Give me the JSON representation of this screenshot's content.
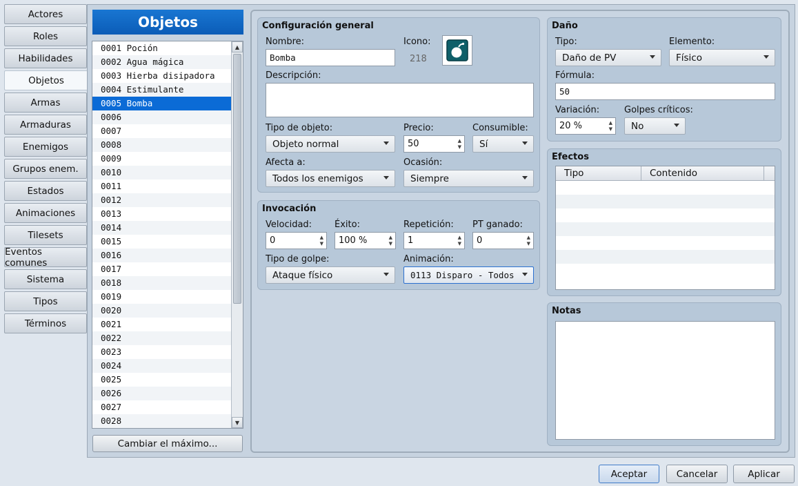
{
  "tabs": [
    "Actores",
    "Roles",
    "Habilidades",
    "Objetos",
    "Armas",
    "Armaduras",
    "Enemigos",
    "Grupos enem.",
    "Estados",
    "Animaciones",
    "Tilesets",
    "Eventos comunes",
    "Sistema",
    "Tipos",
    "Términos"
  ],
  "active_tab": "Objetos",
  "list": {
    "title": "Objetos",
    "items": [
      "0001 Poción",
      "0002 Agua mágica",
      "0003 Hierba disipadora",
      "0004 Estimulante",
      "0005 Bomba",
      "0006",
      "0007",
      "0008",
      "0009",
      "0010",
      "0011",
      "0012",
      "0013",
      "0014",
      "0015",
      "0016",
      "0017",
      "0018",
      "0019",
      "0020",
      "0021",
      "0022",
      "0023",
      "0024",
      "0025",
      "0026",
      "0027",
      "0028"
    ],
    "selected_index": 4,
    "change_max_button": "Cambiar el máximo..."
  },
  "general": {
    "title": "Configuración general",
    "name_label": "Nombre:",
    "name_value": "Bomba",
    "icon_label": "Icono:",
    "icon_index": "218",
    "icon_name": "bomb-icon",
    "description_label": "Descripción:",
    "description_value": "",
    "item_type_label": "Tipo de objeto:",
    "item_type_value": "Objeto normal",
    "price_label": "Precio:",
    "price_value": "50",
    "consumable_label": "Consumible:",
    "consumable_value": "Sí",
    "scope_label": "Afecta a:",
    "scope_value": "Todos los enemigos",
    "occasion_label": "Ocasión:",
    "occasion_value": "Siempre"
  },
  "invocation": {
    "title": "Invocación",
    "speed_label": "Velocidad:",
    "speed_value": "0",
    "success_label": "Éxito:",
    "success_value": "100 %",
    "repeat_label": "Repetición:",
    "repeat_value": "1",
    "tp_label": "PT ganado:",
    "tp_value": "0",
    "hit_type_label": "Tipo de golpe:",
    "hit_type_value": "Ataque físico",
    "animation_label": "Animación:",
    "animation_value": "0113 Disparo - Todos"
  },
  "damage": {
    "title": "Daño",
    "type_label": "Tipo:",
    "type_value": "Daño de PV",
    "element_label": "Elemento:",
    "element_value": "Físico",
    "formula_label": "Fórmula:",
    "formula_value": "50",
    "variance_label": "Variación:",
    "variance_value": "20 %",
    "critical_label": "Golpes críticos:",
    "critical_value": "No"
  },
  "effects": {
    "title": "Efectos",
    "columns": [
      "Tipo",
      "Contenido"
    ]
  },
  "notes": {
    "title": "Notas",
    "value": ""
  },
  "footer": {
    "ok": "Aceptar",
    "cancel": "Cancelar",
    "apply": "Aplicar"
  },
  "colors": {
    "accent": "#0b6bd6",
    "header": "#1976d2",
    "panel": "#c7d3e0",
    "group": "#b7c8d9",
    "icon_bg": "#0e5f69"
  }
}
